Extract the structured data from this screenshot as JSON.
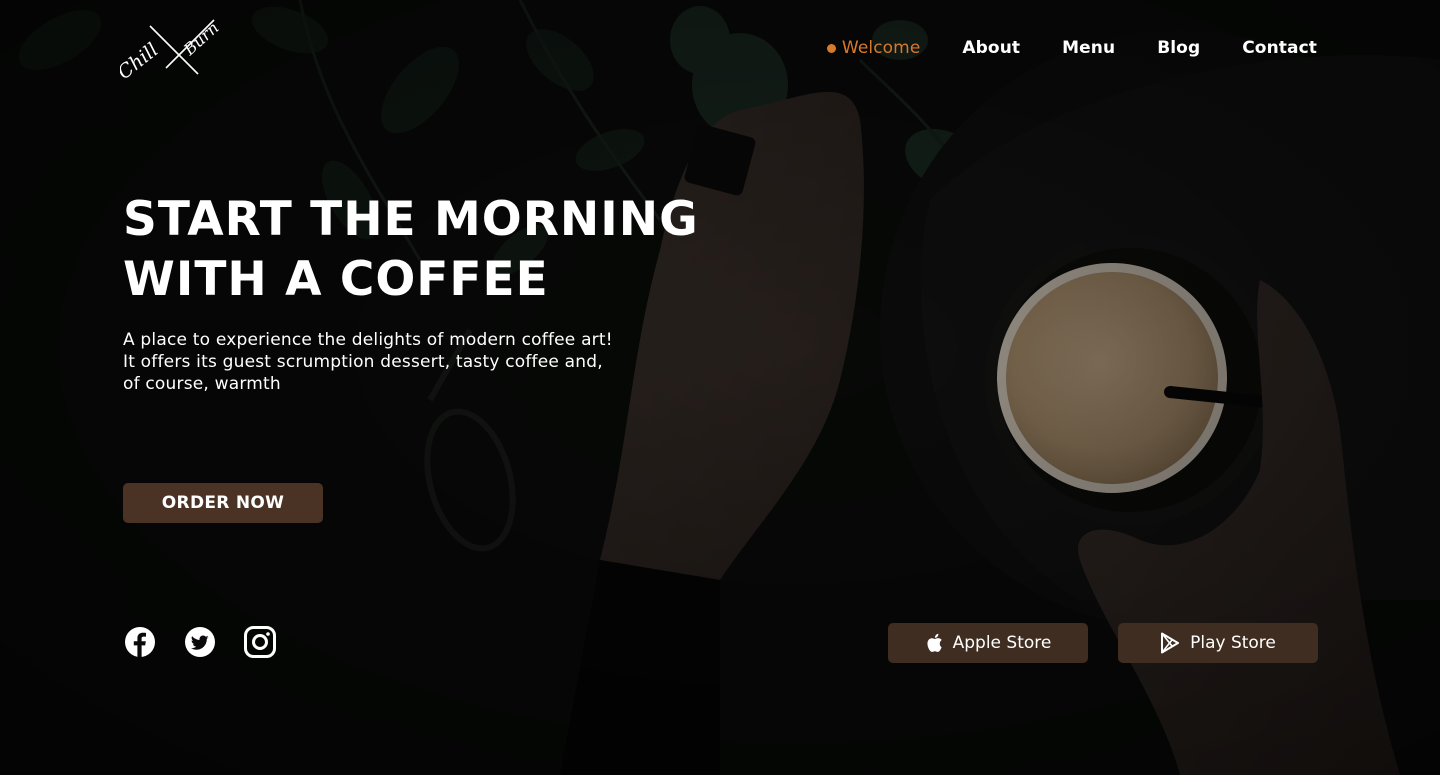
{
  "brand": {
    "logo_word_1": "Chill",
    "logo_word_2": "Burn"
  },
  "nav": {
    "items": [
      {
        "label": "Welcome",
        "active": true
      },
      {
        "label": "About",
        "active": false
      },
      {
        "label": "Menu",
        "active": false
      },
      {
        "label": "Blog",
        "active": false
      },
      {
        "label": "Contact",
        "active": false
      }
    ]
  },
  "hero": {
    "headline_line_1": "START THE MORNING",
    "headline_line_2": "WITH A COFFEE",
    "description_line_1": "A place to experience the delights of modern coffee art!",
    "description_line_2": "It offers its guest scrumption dessert, tasty coffee and,",
    "description_line_3": "of course, warmth",
    "cta_label": "ORDER NOW"
  },
  "social": {
    "icons": [
      "facebook-icon",
      "twitter-icon",
      "instagram-icon"
    ]
  },
  "stores": {
    "apple_label": "Apple Store",
    "play_label": "Play Store"
  },
  "colors": {
    "accent": "#d9792a",
    "button_brown": "#4a3325",
    "store_brown": "#3f2d21",
    "background": "#050605"
  }
}
